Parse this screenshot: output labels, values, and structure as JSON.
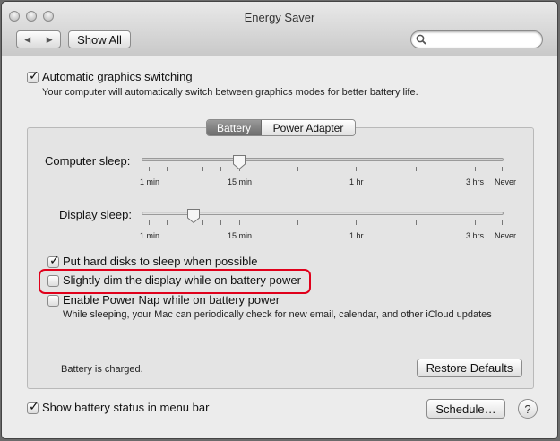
{
  "window": {
    "title": "Energy Saver"
  },
  "toolbar": {
    "back_glyph": "◀",
    "forward_glyph": "▶",
    "show_all_label": "Show All",
    "search_placeholder": ""
  },
  "graphics": {
    "checkbox_label": "Automatic graphics switching",
    "checked": true,
    "description": "Your computer will automatically switch between graphics modes for better battery life."
  },
  "tabs": [
    {
      "label": "Battery",
      "selected": true
    },
    {
      "label": "Power Adapter",
      "selected": false
    }
  ],
  "computer_sleep": {
    "label": "Computer sleep:",
    "value": "15 min",
    "ticks": [
      "1 min",
      "15 min",
      "1 hr",
      "3 hrs",
      "Never"
    ]
  },
  "display_sleep": {
    "label": "Display sleep:",
    "value": "10 min",
    "ticks": [
      "1 min",
      "15 min",
      "1 hr",
      "3 hrs",
      "Never"
    ]
  },
  "options": {
    "hard_disks": {
      "label": "Put hard disks to sleep when possible",
      "checked": true
    },
    "dim_display": {
      "label": "Slightly dim the display while on battery power",
      "checked": false
    },
    "power_nap": {
      "label": "Enable Power Nap while on battery power",
      "checked": false,
      "description": "While sleeping, your Mac can periodically check for new email, calendar, and other iCloud updates"
    }
  },
  "status": {
    "battery_text": "Battery is charged.",
    "restore_label": "Restore Defaults"
  },
  "footer": {
    "menu_bar_label": "Show battery status in menu bar",
    "menu_bar_checked": true,
    "schedule_label": "Schedule…",
    "help_glyph": "?"
  },
  "colors": {
    "highlight": "#e0001b",
    "selected_tab": "#7a7a7a"
  }
}
